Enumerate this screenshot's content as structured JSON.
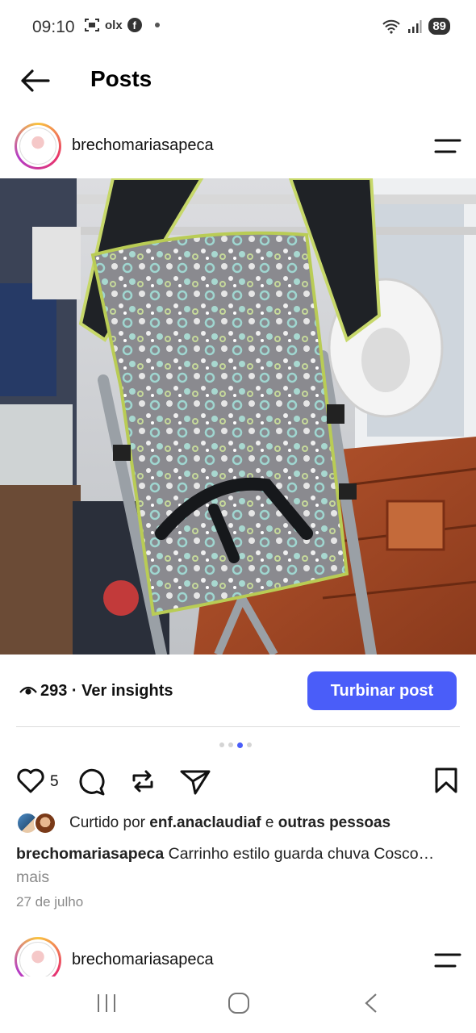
{
  "status_bar": {
    "time": "09:10",
    "left_icons": [
      "screenshot-icon",
      "olx-icon",
      "facebook-icon",
      "dot-icon"
    ],
    "olx_label": "olx",
    "battery": "89"
  },
  "top_bar": {
    "title": "Posts"
  },
  "post": {
    "username": "brechomariasapeca",
    "views": "293 · Ver insights",
    "boost_label": "Turbinar post",
    "carousel": {
      "count": 4,
      "active_index": 2
    },
    "likes_count": "5",
    "liked_by": {
      "prefix": "Curtido por ",
      "user": "enf.anaclaudiaf",
      "middle": " e ",
      "others": "outras pessoas"
    },
    "caption": {
      "username": "brechomariasapeca",
      "text": " Carrinho estilo guarda chuva Cosco",
      "ellipsis": "…",
      "more": " mais"
    },
    "date": "27 de julho"
  },
  "next_post": {
    "username": "brechomariasapeca"
  },
  "colors": {
    "accent": "#4a5df9",
    "secondary_text": "#8a8a8a"
  }
}
